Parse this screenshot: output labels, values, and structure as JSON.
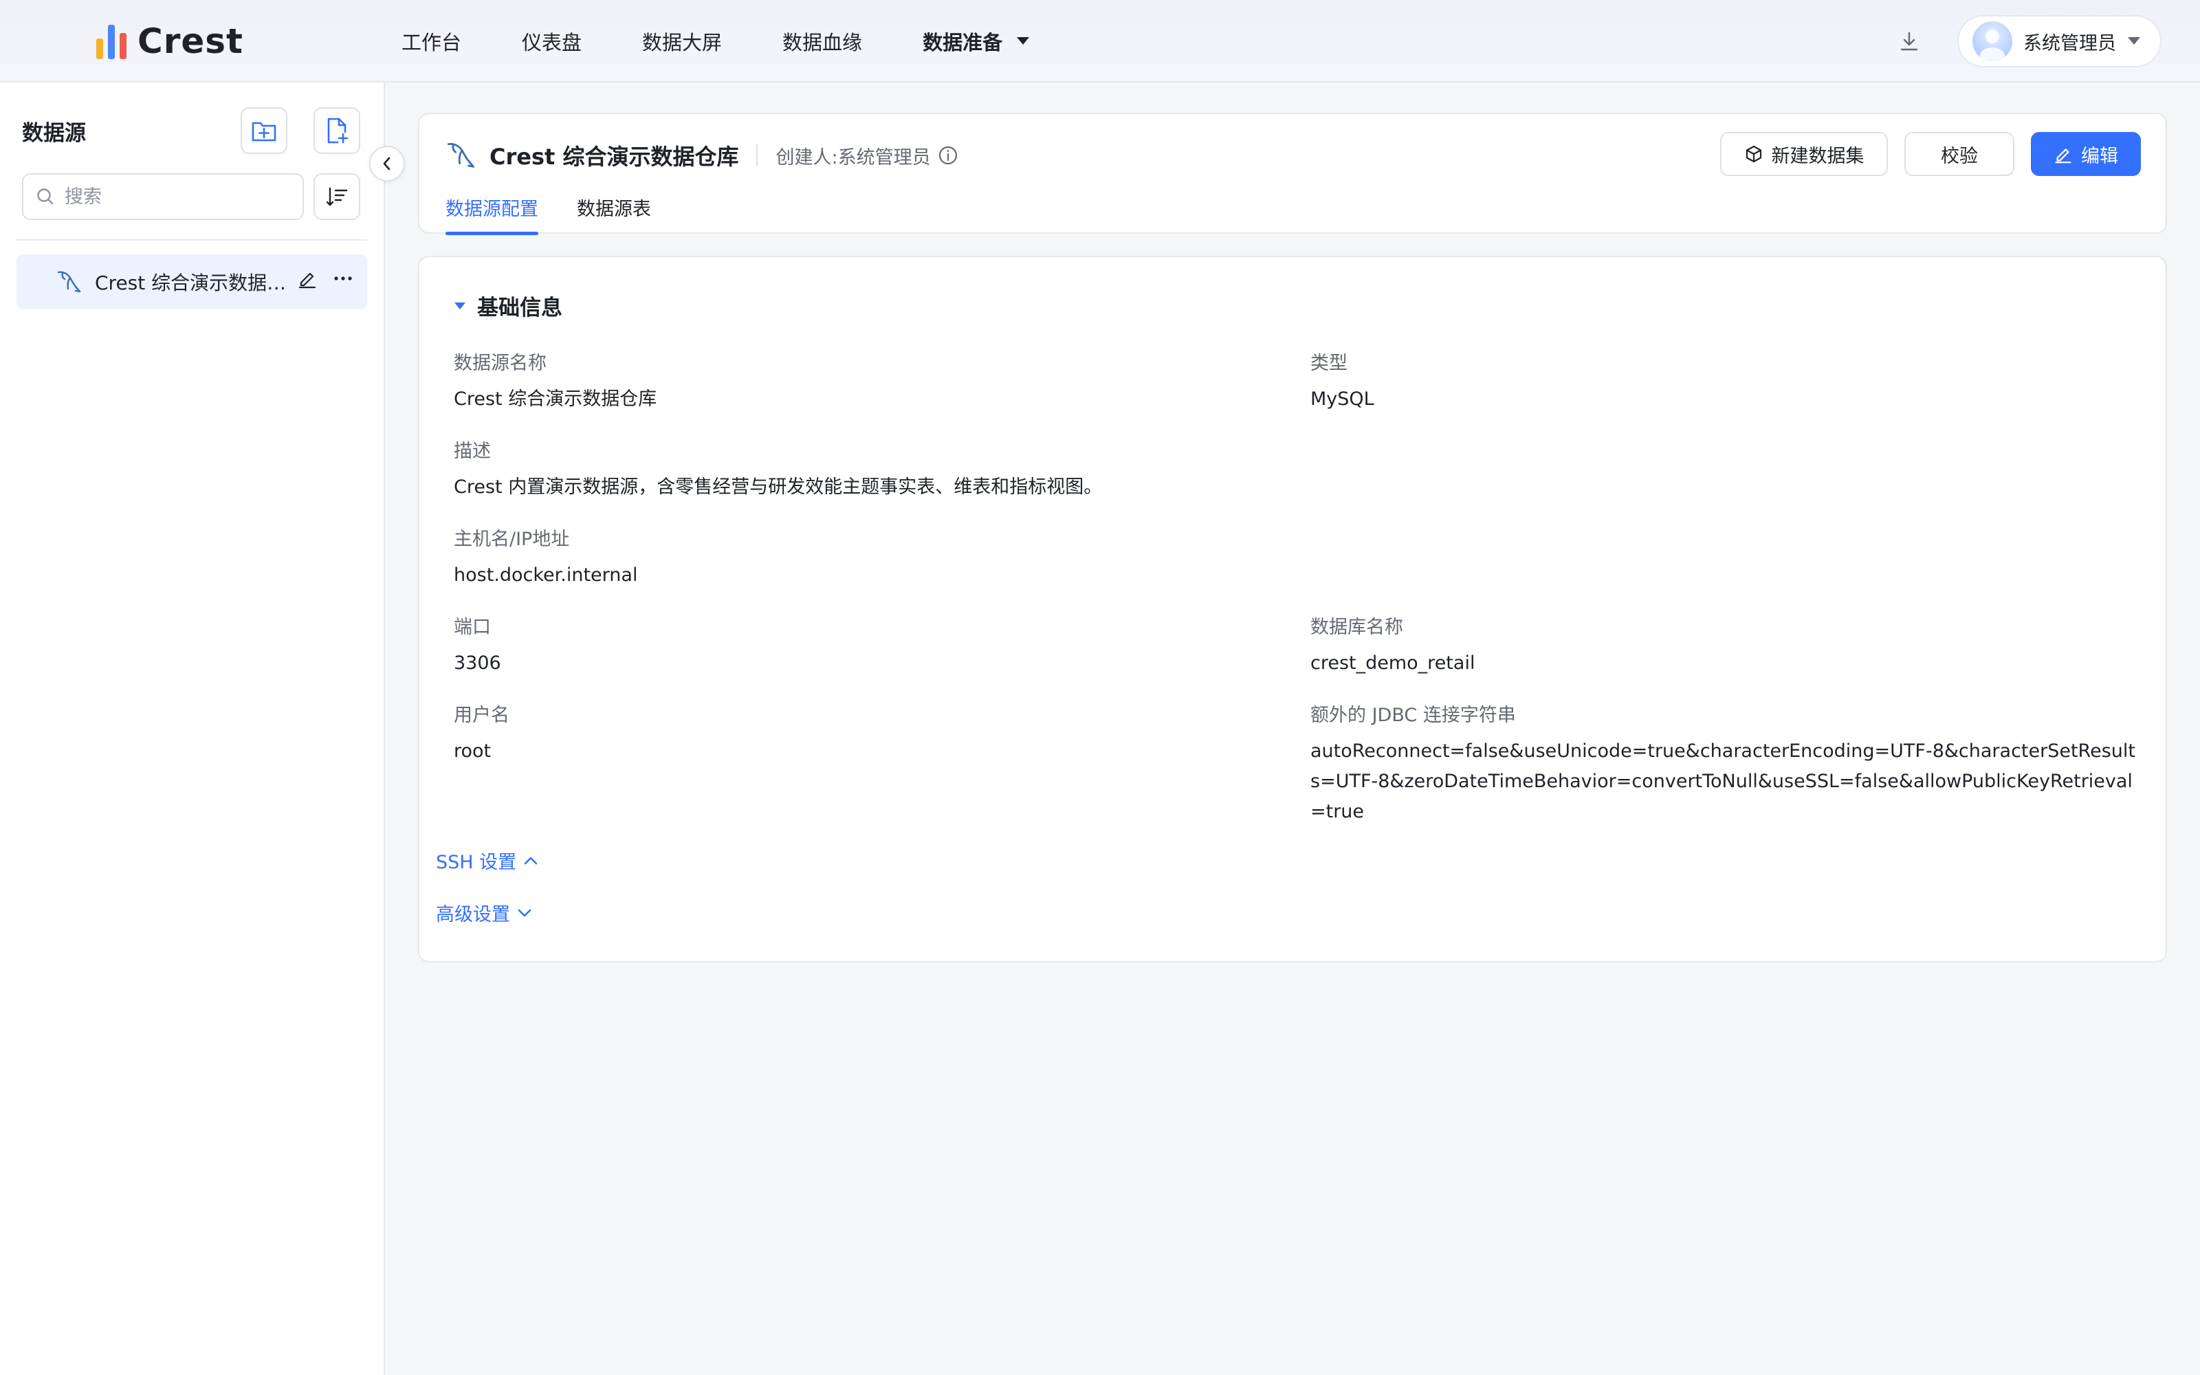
{
  "app": {
    "name": "Crest",
    "brand_colors": [
      "#4a86f7",
      "#f5b12a",
      "#ef5a4c"
    ]
  },
  "nav": {
    "items": [
      "工作台",
      "仪表盘",
      "数据大屏",
      "数据血缘"
    ],
    "active_label": "数据准备"
  },
  "user": {
    "name": "系统管理员"
  },
  "sidebar": {
    "title": "数据源",
    "search_placeholder": "搜索",
    "items": [
      {
        "label": "Crest 综合演示数据仓库"
      }
    ]
  },
  "datasource": {
    "title": "Crest 综合演示数据仓库",
    "creator": "创建人:系统管理员",
    "actions": {
      "new_dataset": "新建数据集",
      "validate": "校验",
      "edit": "编辑"
    },
    "tabs": [
      "数据源配置",
      "数据源表"
    ],
    "active_tab": 0
  },
  "basic_info": {
    "title": "基础信息",
    "fields": {
      "name": {
        "label": "数据源名称",
        "value": "Crest 综合演示数据仓库"
      },
      "type": {
        "label": "类型",
        "value": "MySQL"
      },
      "desc": {
        "label": "描述",
        "value": "Crest 内置演示数据源，含零售经营与研发效能主题事实表、维表和指标视图。"
      },
      "host": {
        "label": "主机名/IP地址",
        "value": "host.docker.internal"
      },
      "port": {
        "label": "端口",
        "value": "3306"
      },
      "dbname": {
        "label": "数据库名称",
        "value": "crest_demo_retail"
      },
      "username": {
        "label": "用户名",
        "value": "root"
      },
      "jdbc": {
        "label": "额外的 JDBC 连接字符串",
        "value": "autoReconnect=false&useUnicode=true&characterEncoding=UTF-8&characterSetResults=UTF-8&zeroDateTimeBehavior=convertToNull&useSSL=false&allowPublicKeyRetrieval=true"
      }
    }
  },
  "links": {
    "ssh": "SSH 设置",
    "advanced": "高级设置"
  },
  "colors": {
    "primary": "#3370ff",
    "selected_bg": "#ecf2ff"
  }
}
